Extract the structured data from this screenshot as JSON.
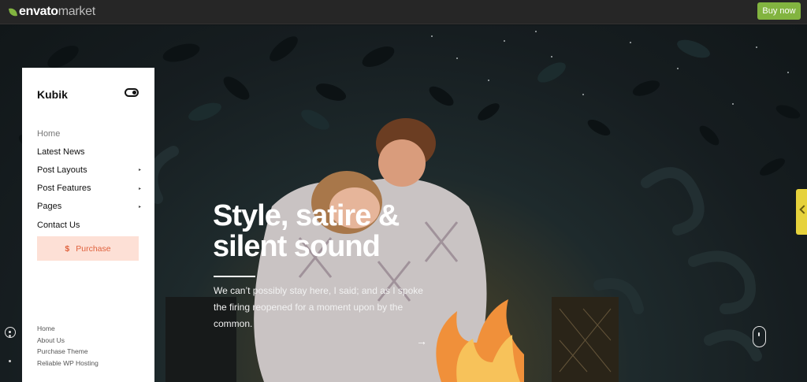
{
  "envato_bar": {
    "logo_bold": "envato",
    "logo_light": "market",
    "buy_label": "Buy now"
  },
  "sidebar": {
    "brand": "Kubik",
    "menu": [
      {
        "label": "Home",
        "active": true
      },
      {
        "label": "Latest News"
      },
      {
        "label": "Post Layouts",
        "arrow": "▸"
      },
      {
        "label": "Post Features",
        "arrow": "▸"
      },
      {
        "label": "Pages",
        "arrow": "▸"
      },
      {
        "label": "Contact Us"
      }
    ],
    "purchase_icon": "$",
    "purchase_label": "Purchase",
    "footer": [
      "Home",
      "About Us",
      "Purchase Theme",
      "Reliable WP Hosting"
    ]
  },
  "hero": {
    "headline": "Style, satire & silent sound",
    "lead": "We can’t possibly stay here, I said; and as I spoke the firing reopened for a moment upon by the common.",
    "arrow": "→"
  },
  "colors": {
    "envato_green": "#82b440",
    "purchase_bg": "#fde0d6",
    "purchase_text": "#e0623e",
    "side_tab": "#e6d23c"
  }
}
